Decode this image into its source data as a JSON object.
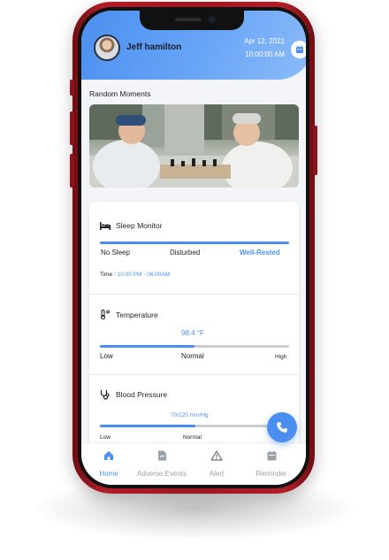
{
  "header": {
    "user_name": "Jeff hamilton",
    "date": "Apr 12, 2021",
    "time": "10:00:00 AM"
  },
  "moments": {
    "title": "Random Moments"
  },
  "sleep": {
    "title": "Sleep Monitor",
    "levels": [
      "No Sleep",
      "Disturbed",
      "Well-Rested"
    ],
    "active_level": "Well-Rested",
    "time_label": "Time :",
    "time_range": "10:00 PM - 06:00AM",
    "progress": 1.0
  },
  "temperature": {
    "title": "Temperature",
    "value": "98.4 °F",
    "low": "Low",
    "normal": "Normal",
    "high": "High",
    "progress": 0.5
  },
  "blood_pressure": {
    "title": "Blood Pressure",
    "value": "70/120 mm/Hg",
    "low": "Low",
    "normal": "Normal",
    "progress": 0.5
  },
  "nav": {
    "items": [
      "Home",
      "Adverse Events",
      "Alert",
      "Reminder"
    ],
    "active": "Home"
  },
  "colors": {
    "accent": "#4a8ff0",
    "phone_frame": "#9c1720"
  }
}
